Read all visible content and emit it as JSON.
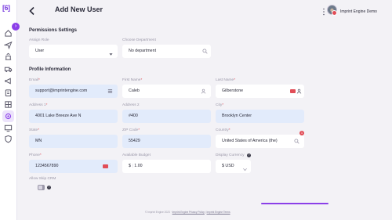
{
  "app": {
    "logo_text": "[6]",
    "company": "Imprint Engine Demo"
  },
  "header": {
    "title": "Add New User"
  },
  "sidebar": {
    "items": [
      {
        "icon": "home-icon"
      },
      {
        "icon": "send-icon"
      },
      {
        "icon": "building-icon"
      },
      {
        "icon": "truck-icon"
      },
      {
        "icon": "megaphone-icon"
      },
      {
        "icon": "clipboard-icon"
      },
      {
        "icon": "grid-icon"
      },
      {
        "icon": "settings-icon",
        "active": true
      },
      {
        "icon": "monitor-icon"
      },
      {
        "icon": "shield-icon"
      }
    ]
  },
  "permissions": {
    "title": "Permissions Settings",
    "assign_role_label": "Assign Role",
    "assign_role_value": "User",
    "department_label": "Choose Department",
    "department_value": "No department"
  },
  "profile": {
    "title": "Profile Information",
    "email_label": "Email",
    "email_value": "support@imprintengine.com",
    "first_name_label": "First Name",
    "first_name_value": "Caleb",
    "last_name_label": "Last Name",
    "last_name_value": "Gilberstone",
    "address1_label": "Address 1",
    "address1_value": "4001 Lake Breeze Ave N",
    "address2_label": "Address 2",
    "address2_value": "#400",
    "city_label": "City",
    "city_value": "Brooklyn Center",
    "state_label": "State",
    "state_value": "MN",
    "zip_label": "ZIP Code",
    "zip_value": "55429",
    "country_label": "Country",
    "country_value": "United States of America (the)",
    "country_badge": "1",
    "phone_label": "Phone",
    "phone_value": "1234567890",
    "budget_label": "Available Budget",
    "budget_currency": "$",
    "budget_value": "1.00",
    "display_currency_label": "Display Currency",
    "display_currency_value": "$ USD",
    "skip_crm_label": "Allow Skip CRM"
  },
  "footer": {
    "copyright": "© Imprint Engine 2023 ·",
    "privacy": "Imprint Engine Privacy Policy",
    "terms": "Imprint Engine Terms"
  },
  "progress": {
    "fraction": 1.0
  },
  "colors": {
    "accent": "#8b3fe8",
    "error": "#e14d57",
    "field_blue": "#e2ebfb"
  }
}
